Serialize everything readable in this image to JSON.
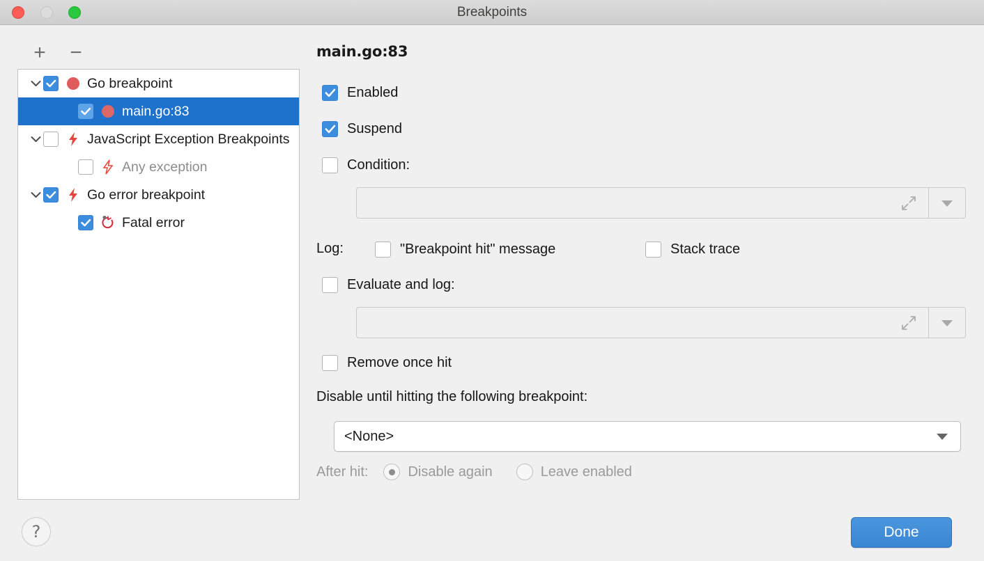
{
  "window": {
    "title": "Breakpoints",
    "traffic_lights": [
      "close-button",
      "minimize-button",
      "maximize-button"
    ]
  },
  "tree_toolbar": {
    "add_label": "+",
    "remove_label": "−"
  },
  "tree": {
    "items": [
      {
        "label": "Go breakpoint",
        "level": 0,
        "expandable": true,
        "expanded": true,
        "checked": true,
        "icon": "red-dot-icon",
        "selected": false,
        "dimmed": false
      },
      {
        "label": "main.go:83",
        "level": 1,
        "expandable": false,
        "expanded": false,
        "checked": true,
        "icon": "red-dot-icon",
        "selected": true,
        "dimmed": false
      },
      {
        "label": "JavaScript Exception Breakpoints",
        "level": 0,
        "expandable": true,
        "expanded": true,
        "checked": false,
        "icon": "lightning-icon",
        "selected": false,
        "dimmed": false
      },
      {
        "label": "Any exception",
        "level": 1,
        "expandable": false,
        "expanded": false,
        "checked": false,
        "icon": "lightning-outline-icon",
        "selected": false,
        "dimmed": true
      },
      {
        "label": "Go error breakpoint",
        "level": 0,
        "expandable": true,
        "expanded": true,
        "checked": true,
        "icon": "lightning-icon",
        "selected": false,
        "dimmed": false
      },
      {
        "label": "Fatal error",
        "level": 1,
        "expandable": false,
        "expanded": false,
        "checked": true,
        "icon": "restart-error-icon",
        "selected": false,
        "dimmed": false
      }
    ]
  },
  "detail": {
    "title": "main.go:83",
    "enabled": {
      "label": "Enabled",
      "checked": true
    },
    "suspend": {
      "label": "Suspend",
      "checked": true
    },
    "condition": {
      "label": "Condition:",
      "checked": false,
      "value": "",
      "expand_icon": "expand-diagonal-icon",
      "dropdown_icon": "chevron-down-icon"
    },
    "log": {
      "label": "Log:",
      "message": {
        "label": "\"Breakpoint hit\" message",
        "checked": false
      },
      "stack_trace": {
        "label": "Stack trace",
        "checked": false
      }
    },
    "evaluate_and_log": {
      "label": "Evaluate and log:",
      "checked": false,
      "value": "",
      "expand_icon": "expand-diagonal-icon",
      "dropdown_icon": "chevron-down-icon"
    },
    "remove_once_hit": {
      "label": "Remove once hit",
      "checked": false
    },
    "disable_until": {
      "label": "Disable until hitting the following breakpoint:",
      "selected_option": "<None>",
      "options": [
        "<None>"
      ]
    },
    "after_hit": {
      "label": "After hit:",
      "options": [
        {
          "label": "Disable again",
          "selected": true
        },
        {
          "label": "Leave enabled",
          "selected": false
        }
      ]
    }
  },
  "footer": {
    "help_label": "?",
    "done_label": "Done"
  },
  "colors": {
    "accent_blue": "#3d8ddf",
    "selection_blue": "#1f72cc",
    "breakpoint_red": "#e05b5b",
    "exception_red": "#e8453c",
    "background": "#f0f0f0",
    "done_button": "#3b86d4"
  }
}
